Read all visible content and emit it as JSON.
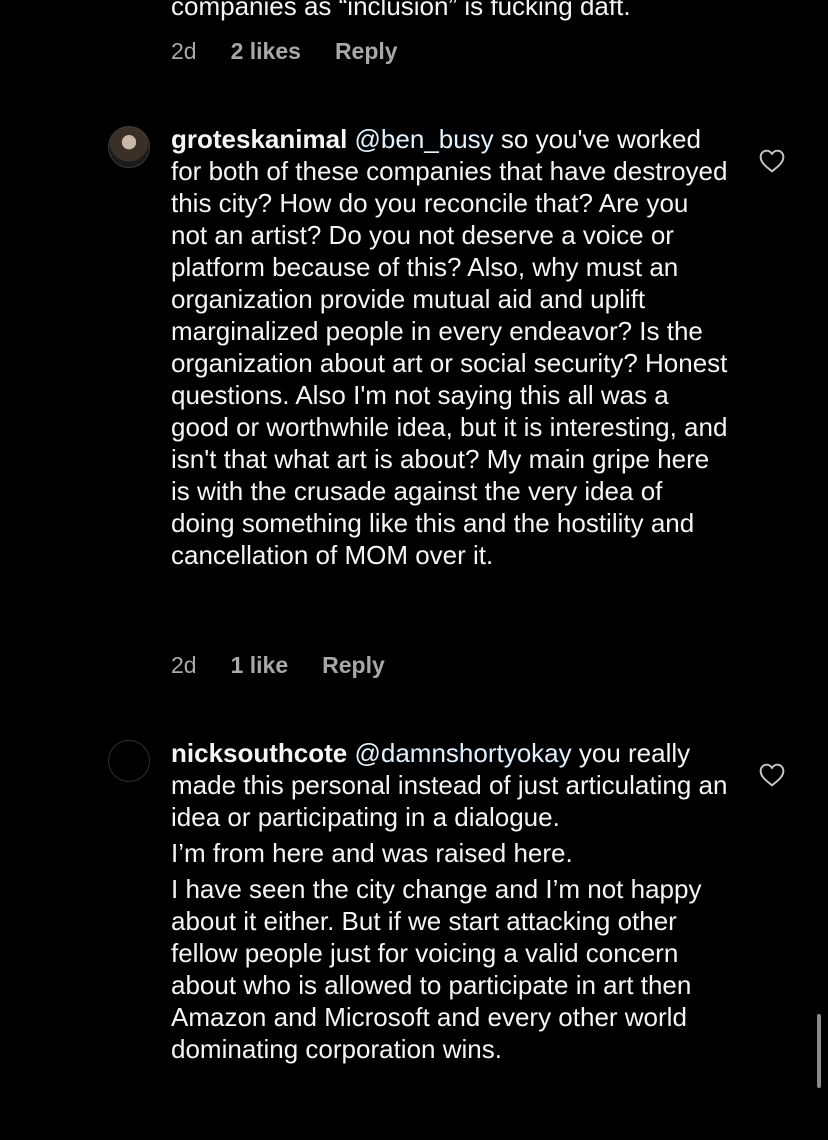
{
  "comments": [
    {
      "partial_text": "companies as “inclusion” is fucking daft.",
      "time": "2d",
      "likes": "2 likes",
      "reply": "Reply"
    },
    {
      "username": "groteskanimal",
      "mention": "@ben_busy",
      "text": " so you've worked for both of these companies that have destroyed this city? How do you reconcile that? Are you not an artist? Do you not deserve a voice or platform because of this? Also, why must an organization provide mutual aid and uplift marginalized people in every endeavor? Is the organization about art or social security?  Honest questions. Also I'm not saying this all was a good or worthwhile idea, but it is interesting, and isn't that what art is about? My main gripe here is with the crusade against the very idea of doing something like this and the hostility and cancellation of MOM over it.",
      "time": "2d",
      "likes": "1 like",
      "reply": "Reply",
      "like_icon": "heart-outline-icon"
    },
    {
      "username": "nicksouthcote",
      "mention": "@damnshortyokay",
      "text": " you really made this personal instead of just articulating an idea or participating in a dialogue.",
      "paragraph2": "I’m from here and was raised here.",
      "paragraph3": "I have seen the city change and I’m not happy about it either. But if we start attacking other fellow people just for voicing a valid concern about who is allowed to participate in art then Amazon and Microsoft and every other world dominating corporation wins.",
      "like_icon": "heart-outline-icon"
    }
  ],
  "colors": {
    "background": "#000000",
    "text": "#f5f5f5",
    "secondary_text": "#a8a8a8",
    "mention": "#e0f1ff"
  }
}
